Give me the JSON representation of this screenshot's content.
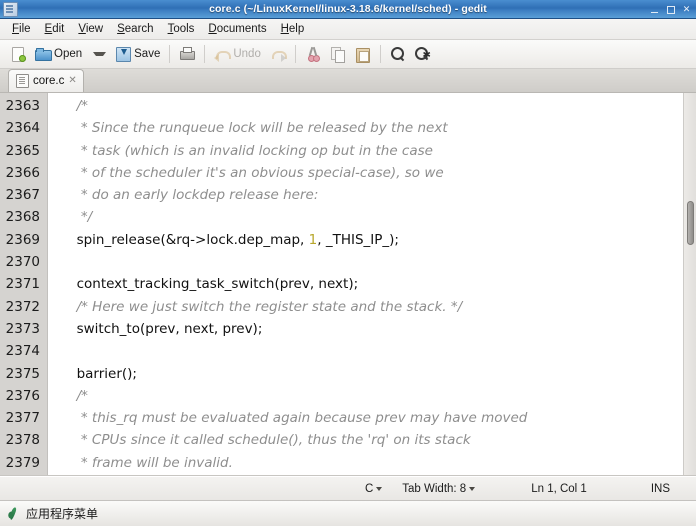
{
  "window": {
    "title": "core.c (~/LinuxKernel/linux-3.18.6/kernel/sched) - gedit",
    "app_icon": "gedit-icon",
    "buttons": {
      "minimize": "minimize-icon",
      "maximize": "maximize-icon",
      "close": "✕"
    }
  },
  "menubar": {
    "items": [
      {
        "mnemonic": "F",
        "rest": "ile"
      },
      {
        "mnemonic": "E",
        "rest": "dit"
      },
      {
        "mnemonic": "V",
        "rest": "iew"
      },
      {
        "mnemonic": "S",
        "rest": "earch"
      },
      {
        "mnemonic": "T",
        "rest": "ools"
      },
      {
        "mnemonic": "D",
        "rest": "ocuments"
      },
      {
        "mnemonic": "H",
        "rest": "elp"
      }
    ]
  },
  "toolbar": {
    "new_icon": "new-document-icon",
    "open_label": "Open",
    "open_icon": "open-folder-icon",
    "save_label": "Save",
    "save_icon": "save-disk-icon",
    "print_icon": "print-icon",
    "undo_label": "Undo",
    "undo_icon": "undo-arrow-icon",
    "redo_icon": "redo-arrow-icon",
    "cut_icon": "cut-scissors-icon",
    "copy_icon": "copy-icon",
    "paste_icon": "paste-clipboard-icon",
    "find_icon": "find-magnifier-icon",
    "replace_icon": "find-replace-magnifier-icon"
  },
  "tabs": [
    {
      "label": "core.c",
      "close": "✕",
      "icon": "file-icon"
    }
  ],
  "editor": {
    "first_line_number": 2363,
    "lines": [
      {
        "n": "2363",
        "segments": [
          {
            "t": "  /*",
            "k": "cm"
          }
        ]
      },
      {
        "n": "2364",
        "segments": [
          {
            "t": "   * Since the runqueue lock will be released by the next",
            "k": "cm"
          }
        ]
      },
      {
        "n": "2365",
        "segments": [
          {
            "t": "   * task (which is an invalid locking op but in the case",
            "k": "cm"
          }
        ]
      },
      {
        "n": "2366",
        "segments": [
          {
            "t": "   * of the scheduler it's an obvious special-case), so we",
            "k": "cm"
          }
        ]
      },
      {
        "n": "2367",
        "segments": [
          {
            "t": "   * do an early lockdep release here:",
            "k": "cm"
          }
        ]
      },
      {
        "n": "2368",
        "segments": [
          {
            "t": "   */",
            "k": "cm"
          }
        ]
      },
      {
        "n": "2369",
        "segments": [
          {
            "t": "  spin_release(&rq->lock.dep_map, ",
            "k": ""
          },
          {
            "t": "1",
            "k": "num"
          },
          {
            "t": ", _THIS_IP_);",
            "k": ""
          }
        ]
      },
      {
        "n": "2370",
        "segments": [
          {
            "t": "",
            "k": ""
          }
        ]
      },
      {
        "n": "2371",
        "segments": [
          {
            "t": "  context_tracking_task_switch(prev, next);",
            "k": ""
          }
        ]
      },
      {
        "n": "2372",
        "segments": [
          {
            "t": "  /* Here we just switch the register state and the stack. */",
            "k": "cm"
          }
        ]
      },
      {
        "n": "2373",
        "segments": [
          {
            "t": "  switch_to(prev, next, prev);",
            "k": ""
          }
        ]
      },
      {
        "n": "2374",
        "segments": [
          {
            "t": "",
            "k": ""
          }
        ]
      },
      {
        "n": "2375",
        "segments": [
          {
            "t": "  barrier();",
            "k": ""
          }
        ]
      },
      {
        "n": "2376",
        "segments": [
          {
            "t": "  /*",
            "k": "cm"
          }
        ]
      },
      {
        "n": "2377",
        "segments": [
          {
            "t": "   * this_rq must be evaluated again because prev may have moved",
            "k": "cm"
          }
        ]
      },
      {
        "n": "2378",
        "segments": [
          {
            "t": "   * CPUs since it called schedule(), thus the 'rq' on its stack",
            "k": "cm"
          }
        ]
      },
      {
        "n": "2379",
        "segments": [
          {
            "t": "   * frame will be invalid.",
            "k": "cm"
          }
        ]
      }
    ],
    "colors": {
      "comment": "#8e8e8e",
      "number": "#b8a72c",
      "text": "#111111",
      "gutter_bg": "#d5d3d0",
      "background": "#ffffff"
    }
  },
  "statusbar": {
    "language": "C",
    "tab_width": "Tab Width: 8",
    "cursor": "Ln 1, Col 1",
    "insert_mode": "INS"
  },
  "taskbar": {
    "menu_label": "应用程序菜单",
    "menu_icon": "application-menu-icon"
  }
}
